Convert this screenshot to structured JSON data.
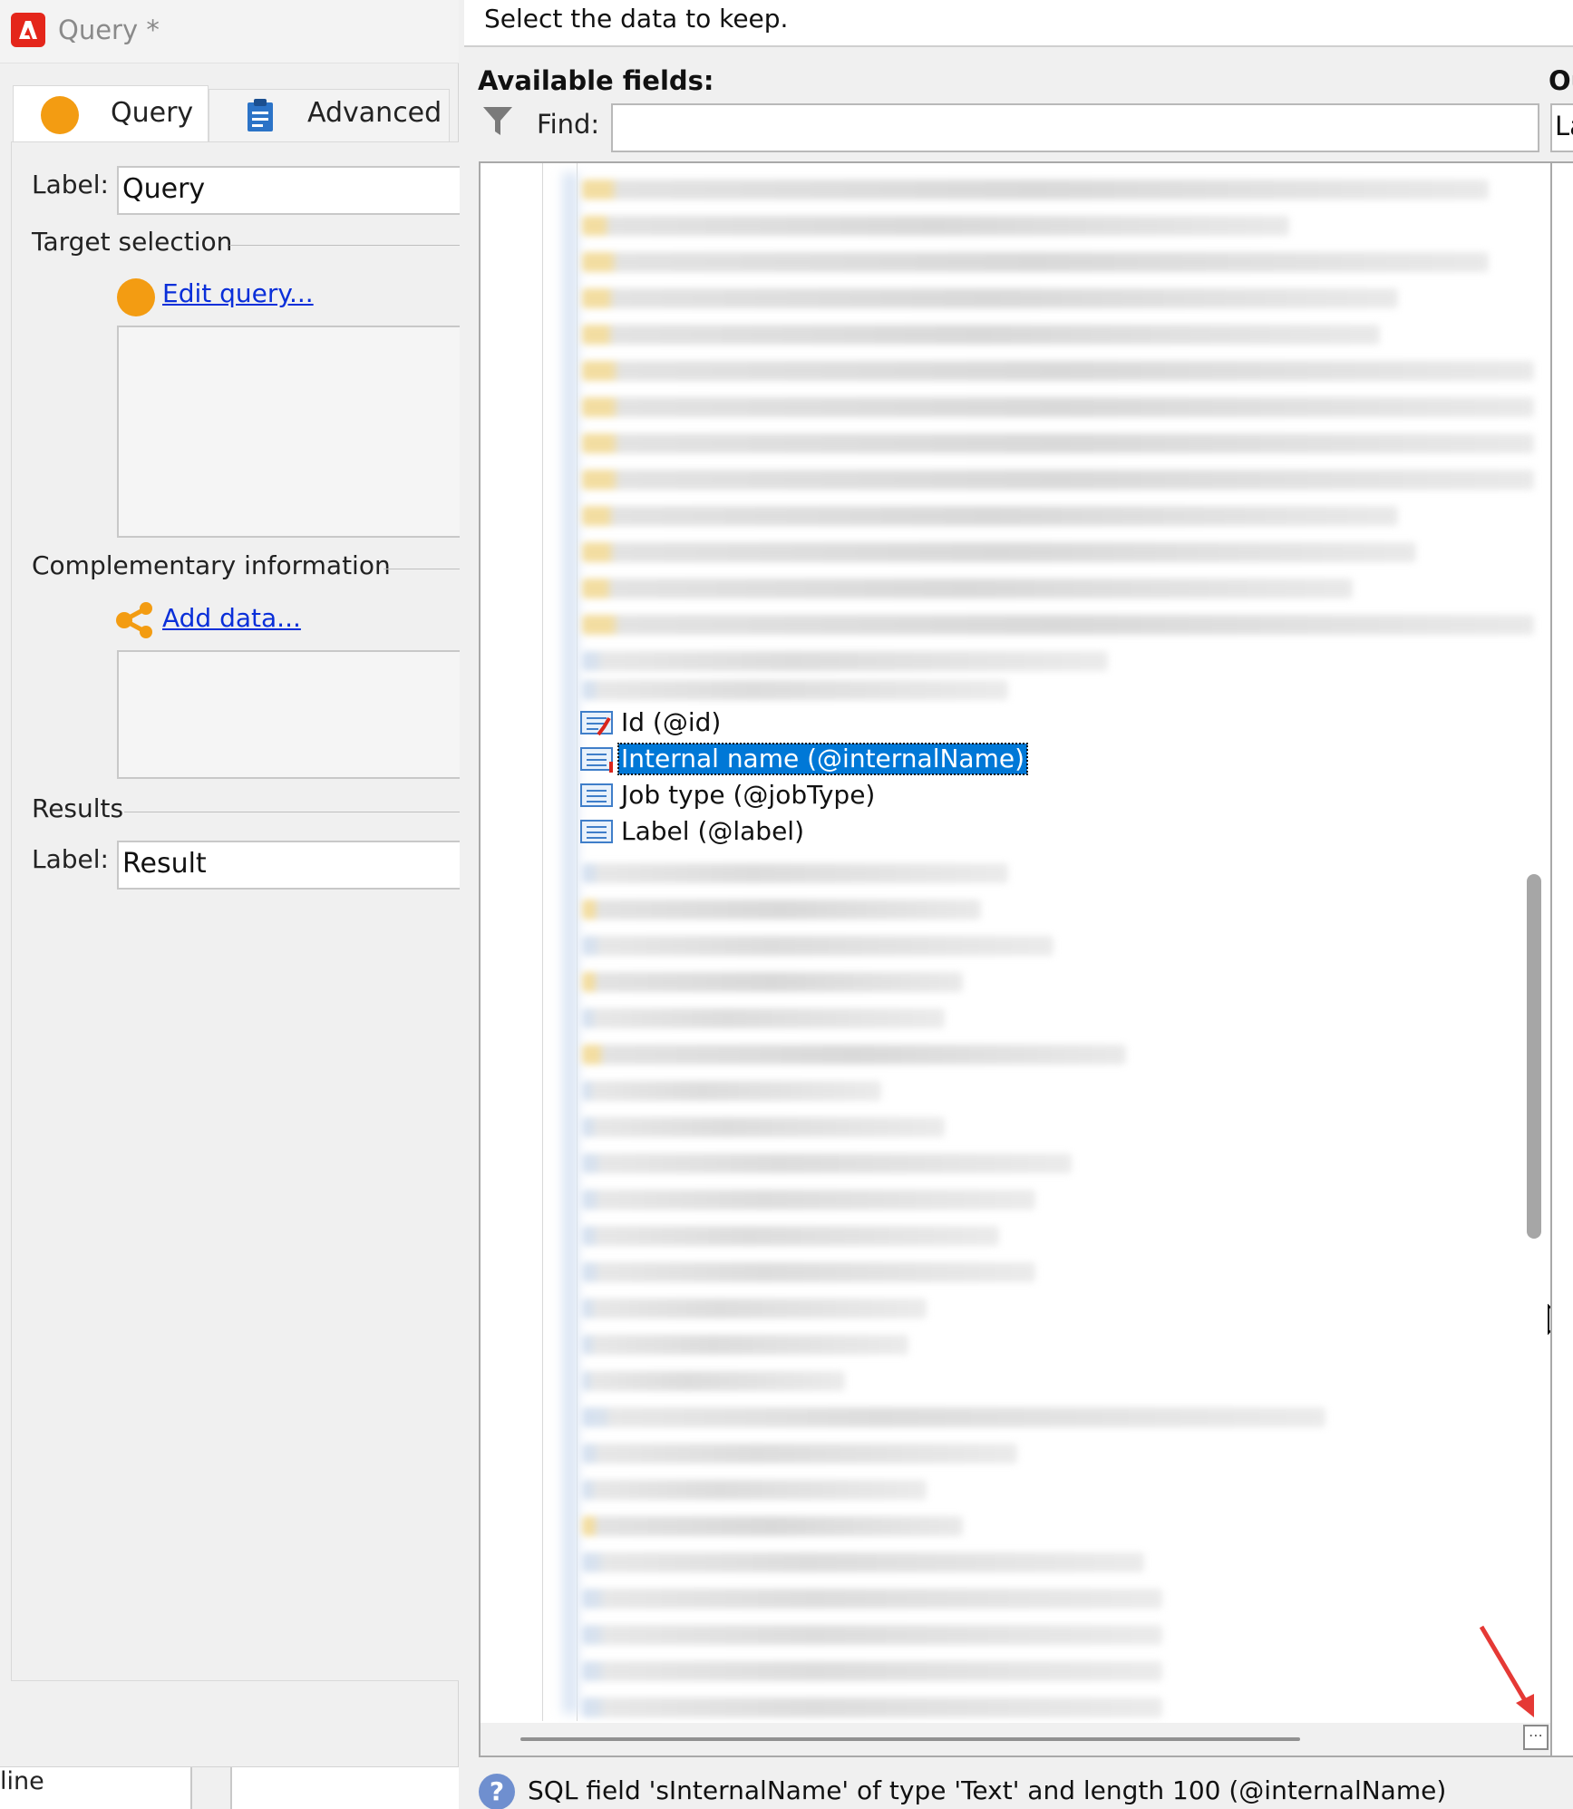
{
  "window": {
    "title": "Query *"
  },
  "tabs": [
    {
      "label": "Query",
      "icon": "query-circle-icon"
    },
    {
      "label": "Advanced",
      "icon": "clipboard-icon"
    }
  ],
  "form": {
    "label_caption": "Label:",
    "label_value": "Query",
    "target_section": "Target selection",
    "edit_query_link": "Edit query...",
    "complementary_section": "Complementary information",
    "add_data_link": "Add data...",
    "results_section": "Results",
    "results_label_caption": "Label:",
    "results_label_value": "Result"
  },
  "footer": {
    "fragment": "line"
  },
  "right": {
    "instruction": "Select the data to keep.",
    "available_title": "Available fields:",
    "output_title": "Ou",
    "find_label": "Find:",
    "find_value": "",
    "output_header_fragment": "La",
    "fields": [
      {
        "label": "Id (@id)",
        "icon": "key-field-icon",
        "selected": false
      },
      {
        "label": "Internal name (@internalName)",
        "icon": "text-field-icon",
        "selected": true
      },
      {
        "label": "Job type (@jobType)",
        "icon": "text-field-icon",
        "selected": false
      },
      {
        "label": "Label (@label)",
        "icon": "text-field-icon",
        "selected": false
      }
    ],
    "status_text": "SQL field 'sInternalName' of type 'Text' and length 100 (@internalName)"
  },
  "colors": {
    "accent": "#f39c12",
    "link": "#0a2fd9",
    "selection": "#0078d7",
    "annotation_arrow": "#e53935",
    "app_logo": "#e4261b"
  }
}
